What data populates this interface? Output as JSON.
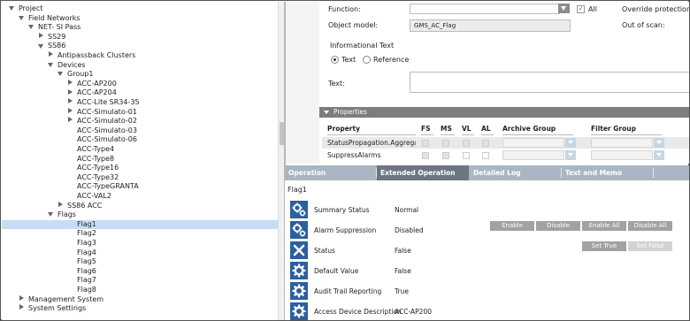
{
  "tree": {
    "items": [
      {
        "label": "Project",
        "state": "expanded"
      },
      {
        "label": "Field Networks",
        "state": "expanded"
      },
      {
        "label": "NET- SI Pass",
        "state": "expanded"
      },
      {
        "label": "SS29",
        "state": "collapsed"
      },
      {
        "label": "SS86",
        "state": "expanded"
      },
      {
        "label": "Antipassback Clusters",
        "state": "collapsed"
      },
      {
        "label": "Devices",
        "state": "expanded"
      },
      {
        "label": "Group1",
        "state": "expanded"
      },
      {
        "label": "ACC-AP200",
        "state": "collapsed"
      },
      {
        "label": "ACC-AP204",
        "state": "collapsed"
      },
      {
        "label": "ACC-Lite SR34-35",
        "state": "collapsed"
      },
      {
        "label": "ACC-Simulato-01",
        "state": "collapsed"
      },
      {
        "label": "ACC-Simulato-02",
        "state": "collapsed"
      },
      {
        "label": "ACC-Simulato-03",
        "state": "none"
      },
      {
        "label": "ACC-Simulato-06",
        "state": "none"
      },
      {
        "label": "ACC-Type4",
        "state": "none"
      },
      {
        "label": "ACC-Type8",
        "state": "none"
      },
      {
        "label": "ACC-Type16",
        "state": "none"
      },
      {
        "label": "ACC-Type32",
        "state": "none"
      },
      {
        "label": "ACC-TypeGRANTA",
        "state": "none"
      },
      {
        "label": "ACC-VAL2",
        "state": "none"
      },
      {
        "label": "SS86 ACC",
        "state": "collapsed"
      },
      {
        "label": "Flags",
        "state": "expanded"
      },
      {
        "label": "Flag1",
        "state": "none",
        "selected": true
      },
      {
        "label": "Flag2",
        "state": "none"
      },
      {
        "label": "Flag3",
        "state": "none"
      },
      {
        "label": "Flag4",
        "state": "none"
      },
      {
        "label": "Flag5",
        "state": "none"
      },
      {
        "label": "Flag6",
        "state": "none"
      },
      {
        "label": "Flag7",
        "state": "none"
      },
      {
        "label": "Flag8",
        "state": "none"
      },
      {
        "label": "Management System",
        "state": "collapsed"
      },
      {
        "label": "System Settings",
        "state": "collapsed"
      }
    ]
  },
  "details": {
    "function_label": "Function:",
    "all_label": "All",
    "all_checked": true,
    "override_label": "Override protection",
    "object_model_label": "Object model:",
    "object_model_value": "GMS_AC_Flag",
    "out_of_scan_label": "Out of scan:",
    "info_text_label": "Informational Text",
    "radio_text": "Text",
    "radio_reference": "Reference",
    "text_label": "Text:"
  },
  "properties": {
    "title": "Properties",
    "columns": [
      "Property",
      "FS",
      "MS",
      "VL",
      "AL",
      "Archive Group",
      "Filter Group"
    ],
    "rows": [
      {
        "name": "StatusPropagation.Aggregat"
      },
      {
        "name": "SuppressAlarms"
      }
    ]
  },
  "operations": {
    "tabs": [
      "Operation",
      "Extended Operation",
      "Detailed Log",
      "Text and Memo"
    ],
    "active_tab": 1,
    "object_name": "Flag1",
    "rows": [
      {
        "label": "Summary Status",
        "value": "Normal",
        "icon": "gears-icon"
      },
      {
        "label": "Alarm Suppression",
        "value": "Disabled",
        "icon": "gears-icon"
      },
      {
        "label": "Status",
        "value": "False",
        "icon": "x-mark-icon"
      },
      {
        "label": "Default Value",
        "value": "False",
        "icon": "gear-icon"
      },
      {
        "label": "Audit Trail Reporting",
        "value": "True",
        "icon": "gear-icon"
      },
      {
        "label": "Access Device Description",
        "value": "ACC-AP200",
        "icon": "gear-icon"
      }
    ],
    "buttons": {
      "enable": "Enable",
      "disable": "Disable",
      "enable_all": "Enable All",
      "disable_all": "Disable All",
      "set_true": "Set True",
      "set_false": "Set False"
    }
  },
  "colors": {
    "selection": "#c5def5",
    "icon_blue": "#2c5f9e",
    "tab_bar": "#a9b6c4",
    "tab_active": "#6c7682",
    "properties_header": "#7d7d7d"
  }
}
